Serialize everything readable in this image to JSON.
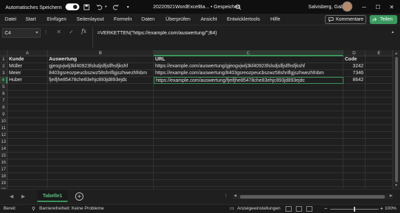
{
  "titlebar": {
    "autosave_label": "Automatisches Speichern",
    "toggle_state": "Ein",
    "doc_title": "20220921WordExcelBa... • Gespeichert",
    "user_name": "Salvisberg, Gaby",
    "icons": [
      "save-icon",
      "undo-icon",
      "redo-icon",
      "customize-icon",
      "search-icon",
      "minimize-icon",
      "maximize-icon",
      "close-icon"
    ]
  },
  "ribbon": {
    "tabs": [
      "Datei",
      "Start",
      "Einfügen",
      "Seitenlayout",
      "Formeln",
      "Daten",
      "Überprüfen",
      "Ansicht",
      "Entwicklertools",
      "Hilfe"
    ],
    "comments_label": "Kommentare",
    "share_label": "Teilen"
  },
  "formula_bar": {
    "name_box": "C4",
    "fx": "fx",
    "formula": "=VERKETTEN(\"https://example.com/auswertung/\";B4)"
  },
  "grid": {
    "columns": [
      "A",
      "B",
      "C",
      "D",
      "E"
    ],
    "active_column": "C",
    "active_row": "4",
    "rows": [
      "1",
      "2",
      "3",
      "4",
      "5",
      "6",
      "7",
      "8",
      "9",
      "10",
      "11",
      "12",
      "13",
      "14",
      "15",
      "16",
      "17",
      "18",
      "19",
      "20"
    ],
    "headers": {
      "a": "Kunde",
      "b": "Auswertung",
      "c": "URL",
      "d": "Code"
    },
    "data": [
      {
        "a": "Müller",
        "b": "gjeogvjwlj3kf40923fslsdjslfjslfhsfjkshf",
        "c": "https://example.com/auswertung/gjeogvjwlj3kf40923fslsdjslfjslfhsfjkshf",
        "d": "3242"
      },
      {
        "a": "Meier",
        "b": "8403gsreozpeucbszwz58shriflgjszhwezhfnbm",
        "c": "https://example.com/auswertung/8403gsreozpeucbszwz58shriflgjszhwezhfnbm",
        "d": "7346"
      },
      {
        "a": "Huber",
        "b": "fjeifjhe85478che83ehjc893jd893ejdc",
        "c": "https://example.com/auswertung/fjeifjhe85478che83ehjc893jd893ejdc",
        "d": "8642"
      }
    ]
  },
  "sheets": {
    "active": "Tabelle1"
  },
  "statusbar": {
    "ready": "Bereit",
    "accessibility": "Barrierefreiheit: Keine Probleme",
    "display_settings": "Anzeigeeinstellungen",
    "zoom": "100%"
  },
  "colors": {
    "accent": "#3b9a5f",
    "background": "#1f1f1f"
  }
}
